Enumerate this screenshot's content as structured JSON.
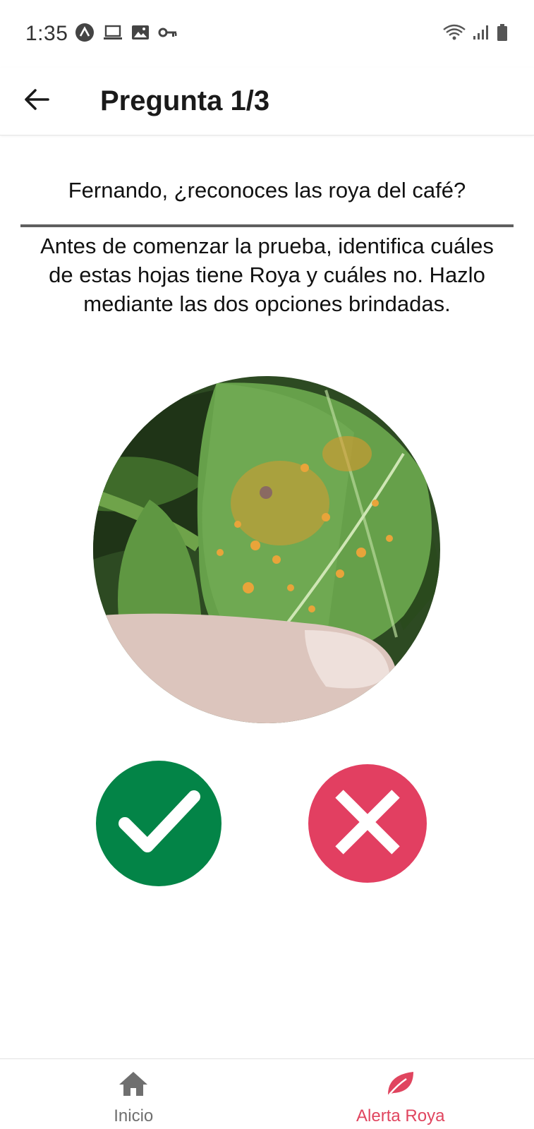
{
  "status_bar": {
    "time": "1:35",
    "left_icons": [
      "app-a-icon",
      "laptop-icon",
      "image-icon",
      "key-icon"
    ],
    "right_icons": [
      "wifi-icon",
      "signal-icon",
      "battery-icon"
    ]
  },
  "header": {
    "back_icon": "arrow-left-icon",
    "title": "Pregunta 1/3"
  },
  "quiz": {
    "question": "Fernando, ¿reconoces las roya del café?",
    "instructions": "Antes de comenzar la prueba, identifica cuáles de estas hojas tiene Roya y cuáles no. Hazlo mediante las dos opciones brindadas.",
    "image_subject": "coffee-leaf-with-rust",
    "yes_icon": "check-icon",
    "no_icon": "x-icon"
  },
  "colors": {
    "yes": "#038447",
    "no": "#e23f61",
    "active_tab": "#e0455f",
    "inactive_tab": "#6f6f6f"
  },
  "bottom_nav": {
    "items": [
      {
        "label": "Inicio",
        "icon": "home-icon",
        "active": false
      },
      {
        "label": "Alerta Roya",
        "icon": "leaf-icon",
        "active": true
      }
    ]
  }
}
